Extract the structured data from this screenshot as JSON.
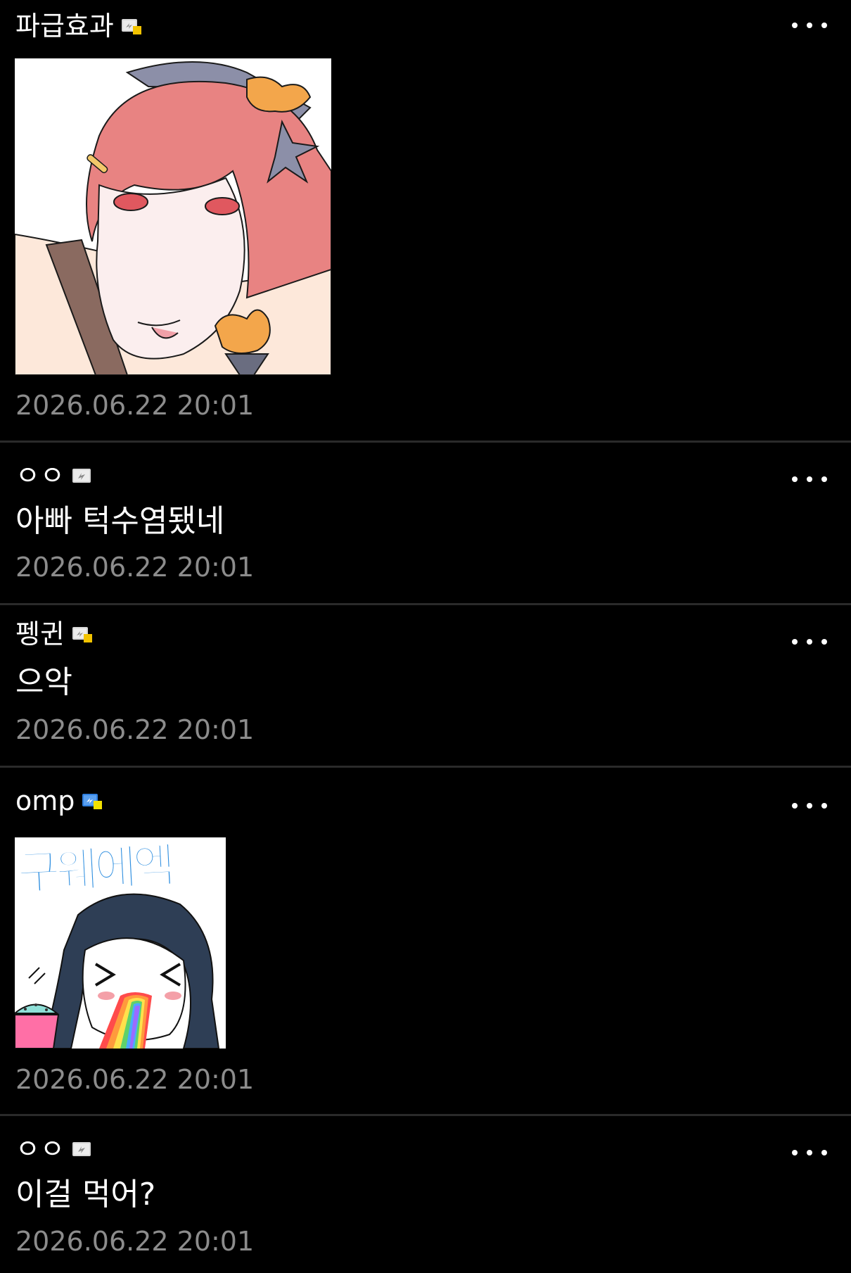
{
  "comments": [
    {
      "author": "파급효과",
      "badge": "gallery-member-badge-gold",
      "sticker": "pink-haired-girl-sticker",
      "time": "2026.06.22 20:01",
      "more": "more-options"
    },
    {
      "author": "ㅇㅇ",
      "badge": "guest-badge-gray",
      "text": "아빠 턱수염됐네",
      "time": "2026.06.22 20:01",
      "more": "more-options"
    },
    {
      "author": "펭귄",
      "badge": "gallery-member-badge-gold",
      "text": "으악",
      "time": "2026.06.22 20:01",
      "more": "more-options"
    },
    {
      "author": "omp",
      "badge": "gallery-member-badge-blue",
      "sticker_text": "구웨에엑",
      "sticker": "rainbow-vomit-sticker",
      "time": "2026.06.22 20:01",
      "more": "more-options"
    },
    {
      "author": "ㅇㅇ",
      "badge": "guest-badge-gray",
      "text": "이걸 먹어?",
      "time": "2026.06.22 20:01",
      "more": "more-options"
    }
  ],
  "colors": {
    "background": "#000000",
    "divider": "#2a2a2a",
    "timestamp": "#8c8c8c",
    "text": "#ffffff",
    "sticker_text": "#2f8fe0"
  }
}
